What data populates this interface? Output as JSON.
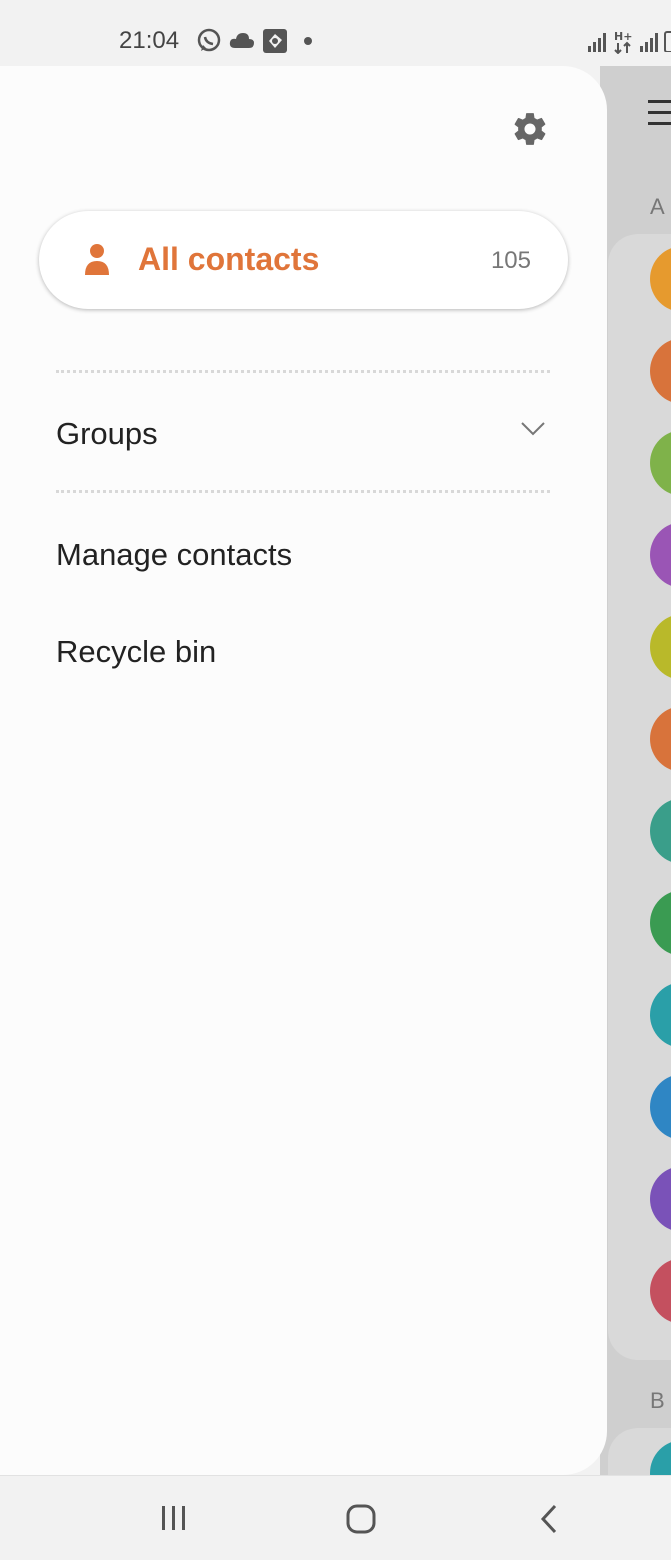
{
  "status_bar": {
    "time": "21:04",
    "icons": [
      "whatsapp-icon",
      "cloud-icon",
      "gallery-icon",
      "notification-dot",
      "signal-icon",
      "data-icon",
      "signal-icon",
      "battery-icon"
    ]
  },
  "drawer": {
    "settings_icon": "gear-icon",
    "all_contacts": {
      "label": "All contacts",
      "count": "105",
      "icon": "person-icon"
    },
    "groups": {
      "label": "Groups",
      "icon": "chevron-down-icon"
    },
    "manage_contacts": {
      "label": "Manage contacts"
    },
    "recycle_bin": {
      "label": "Recycle bin"
    }
  },
  "background_list": {
    "menu_icon": "hamburger-icon",
    "sections": [
      {
        "letter": "A",
        "avatar_colors": [
          "#e69a2e",
          "#d8733b",
          "#7fb24a",
          "#9a55b5",
          "#b9b92a",
          "#d8733b",
          "#3a9e8a",
          "#3a9b52",
          "#2a9fa8",
          "#2f86c4",
          "#7a52b8",
          "#c4505f"
        ]
      },
      {
        "letter": "B",
        "avatar_colors": [
          "#2a9fa8"
        ]
      }
    ]
  },
  "colors": {
    "accent": "#e0753a",
    "drawer_bg": "#fcfcfc",
    "scrim": "#cfcfcf"
  },
  "nav_bar": {
    "buttons": [
      "recents-icon",
      "home-icon",
      "back-icon"
    ]
  }
}
